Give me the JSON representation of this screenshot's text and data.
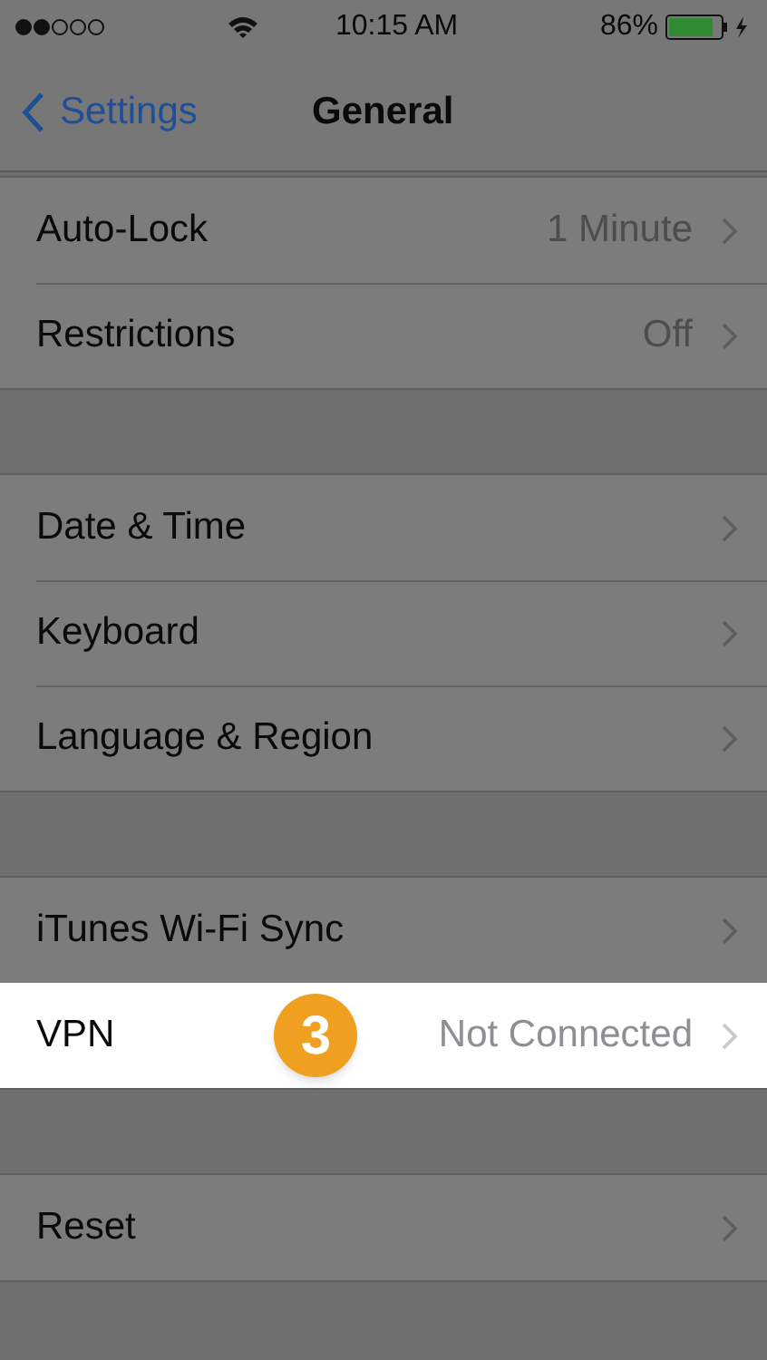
{
  "status_bar": {
    "time": "10:15 AM",
    "battery": "86%"
  },
  "nav": {
    "back": "Settings",
    "title": "General"
  },
  "groups": [
    {
      "rows": [
        {
          "label": "Auto-Lock",
          "value": "1 Minute",
          "highlighted": false
        },
        {
          "label": "Restrictions",
          "value": "Off",
          "highlighted": false
        }
      ]
    },
    {
      "rows": [
        {
          "label": "Date & Time",
          "highlighted": false
        },
        {
          "label": "Keyboard",
          "highlighted": false
        },
        {
          "label": "Language & Region",
          "highlighted": false
        }
      ]
    },
    {
      "rows": [
        {
          "label": "iTunes Wi-Fi Sync",
          "highlighted": false
        },
        {
          "label": "VPN",
          "value": "Not Connected",
          "badge": "3",
          "highlighted": true
        }
      ]
    },
    {
      "rows": [
        {
          "label": "Reset",
          "highlighted": false
        }
      ]
    }
  ]
}
